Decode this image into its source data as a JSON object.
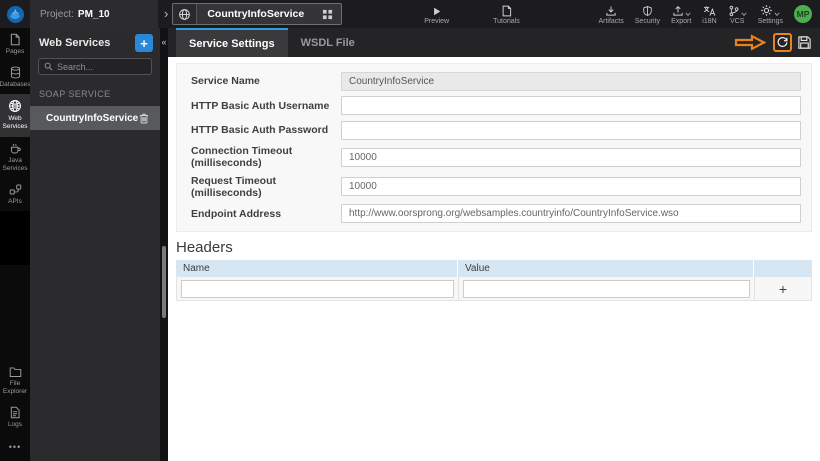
{
  "topbar": {
    "project_label": "Project:",
    "project_name": "PM_10",
    "service_tab_label": "CountryInfoService",
    "preview_label": "Preview",
    "tutorials_label": "Tutorials",
    "artifacts_label": "Artifacts",
    "security_label": "Security",
    "export_label": "Export",
    "i18n_label": "i18N",
    "vcs_label": "VCS",
    "settings_label": "Settings",
    "avatar_initials": "MP"
  },
  "sidebar": {
    "items": [
      {
        "label": "Pages"
      },
      {
        "label": "Databases"
      },
      {
        "label": "Web Services"
      },
      {
        "label": "Java Services"
      },
      {
        "label": "APIs"
      }
    ],
    "file_explorer_label": "File Explorer",
    "logs_label": "Logs",
    "more_label": "•••"
  },
  "panel": {
    "title": "Web Services",
    "add_button_label": "+",
    "collapse_glyph": "«",
    "search_placeholder": "Search...",
    "section_title": "SOAP SERVICE",
    "service_item": "CountryInfoService"
  },
  "tabs": {
    "service_settings": "Service Settings",
    "wsdl_file": "WSDL File"
  },
  "form": {
    "fields": [
      {
        "label": "Service Name",
        "value": "CountryInfoService"
      },
      {
        "label": "HTTP Basic Auth Username",
        "value": ""
      },
      {
        "label": "HTTP Basic Auth Password",
        "value": ""
      },
      {
        "label": "Connection Timeout (milliseconds)",
        "value": "10000"
      },
      {
        "label": "Request Timeout (milliseconds)",
        "value": "10000"
      },
      {
        "label": "Endpoint Address",
        "value": "http://www.oorsprong.org/websamples.countryinfo/CountryInfoService.wso"
      }
    ]
  },
  "headers_section": {
    "title": "Headers",
    "name_column": "Name",
    "value_column": "Value",
    "add_row_label": "+",
    "row": {
      "name": "",
      "value": ""
    }
  },
  "colors": {
    "accent_blue": "#2e9fe6",
    "annotation_orange": "#e8821e",
    "avatar_green": "#4cae4f",
    "table_header_blue": "#d7e6f3"
  }
}
